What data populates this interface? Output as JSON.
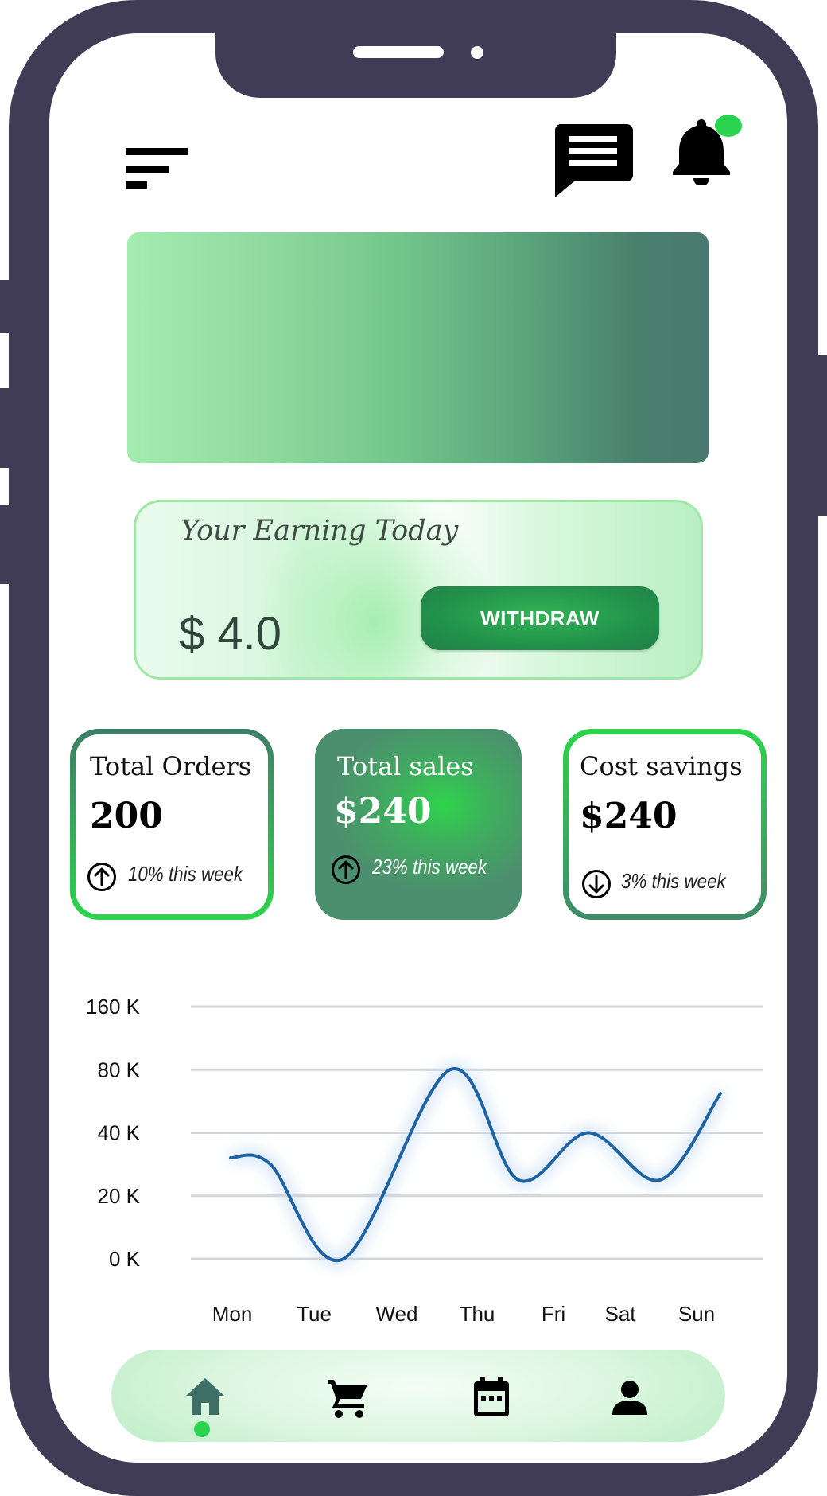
{
  "icons": {
    "menu": "menu-icon",
    "chat": "chat-icon",
    "notifications": "bell-icon",
    "home": "home-icon",
    "cart": "cart-icon",
    "calendar": "calendar-icon",
    "profile": "person-icon"
  },
  "earning": {
    "title": "Your Earning Today",
    "amount": "$ 4.0",
    "withdraw_label": "WITHDRAW"
  },
  "stats": [
    {
      "title": "Total Orders",
      "value": "200",
      "change": "10% this week",
      "trend": "up"
    },
    {
      "title": "Total sales",
      "value": "$240",
      "change": "23% this week",
      "trend": "up"
    },
    {
      "title": "Cost savings",
      "value": "$240",
      "change": "3% this week",
      "trend": "down"
    }
  ],
  "chart_data": {
    "type": "line",
    "categories": [
      "Mon",
      "Tue",
      "Wed",
      "Thu",
      "Fri",
      "Sat",
      "Sun"
    ],
    "y_tick_labels": [
      "0 K",
      "20 K",
      "40 K",
      "80 K",
      "160 K"
    ],
    "series": [
      {
        "values": [
          30,
          0,
          80,
          25,
          40,
          25,
          65
        ],
        "color": "#1f63a3"
      }
    ],
    "ylim": [
      0,
      160
    ],
    "grid": true
  },
  "bottom_nav": {
    "items": [
      "home",
      "cart",
      "calendar",
      "profile"
    ],
    "active": "home"
  },
  "colors": {
    "frame": "#403c55",
    "accent_green": "#2bd44f",
    "line": "#1f63a3"
  }
}
